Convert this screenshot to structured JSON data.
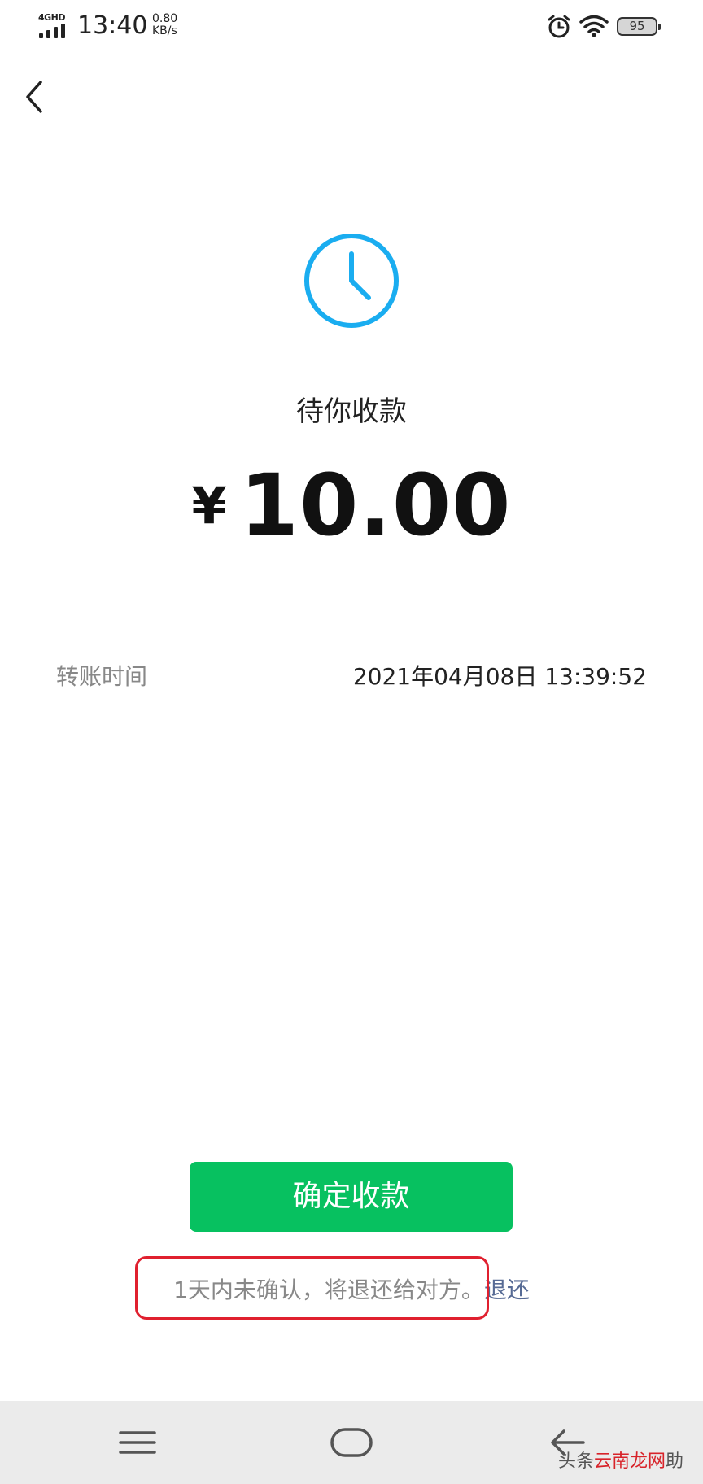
{
  "status_bar": {
    "network": "4GHD",
    "time": "13:40",
    "speed_value": "0.80",
    "speed_unit": "KB/s",
    "battery": "95"
  },
  "transfer": {
    "status_title": "待你收款",
    "currency_symbol": "¥",
    "amount": "10.00",
    "time_label": "转账时间",
    "time_value": "2021年04月08日 13:39:52"
  },
  "actions": {
    "confirm_label": "确定收款",
    "refund_note": "1天内未确认，将退还给对方。",
    "refund_link": "退还"
  },
  "watermark": {
    "prefix": "头条",
    "highlight": "云南龙网",
    "suffix": "助"
  },
  "colors": {
    "accent_green": "#07c160",
    "clock_blue": "#1aadf0",
    "link_blue": "#576b95",
    "highlight_red": "#e0202f"
  },
  "icons": [
    "back-arrow-icon",
    "clock-icon",
    "alarm-icon",
    "wifi-icon",
    "battery-icon",
    "menu-icon",
    "home-icon",
    "back-nav-icon"
  ]
}
